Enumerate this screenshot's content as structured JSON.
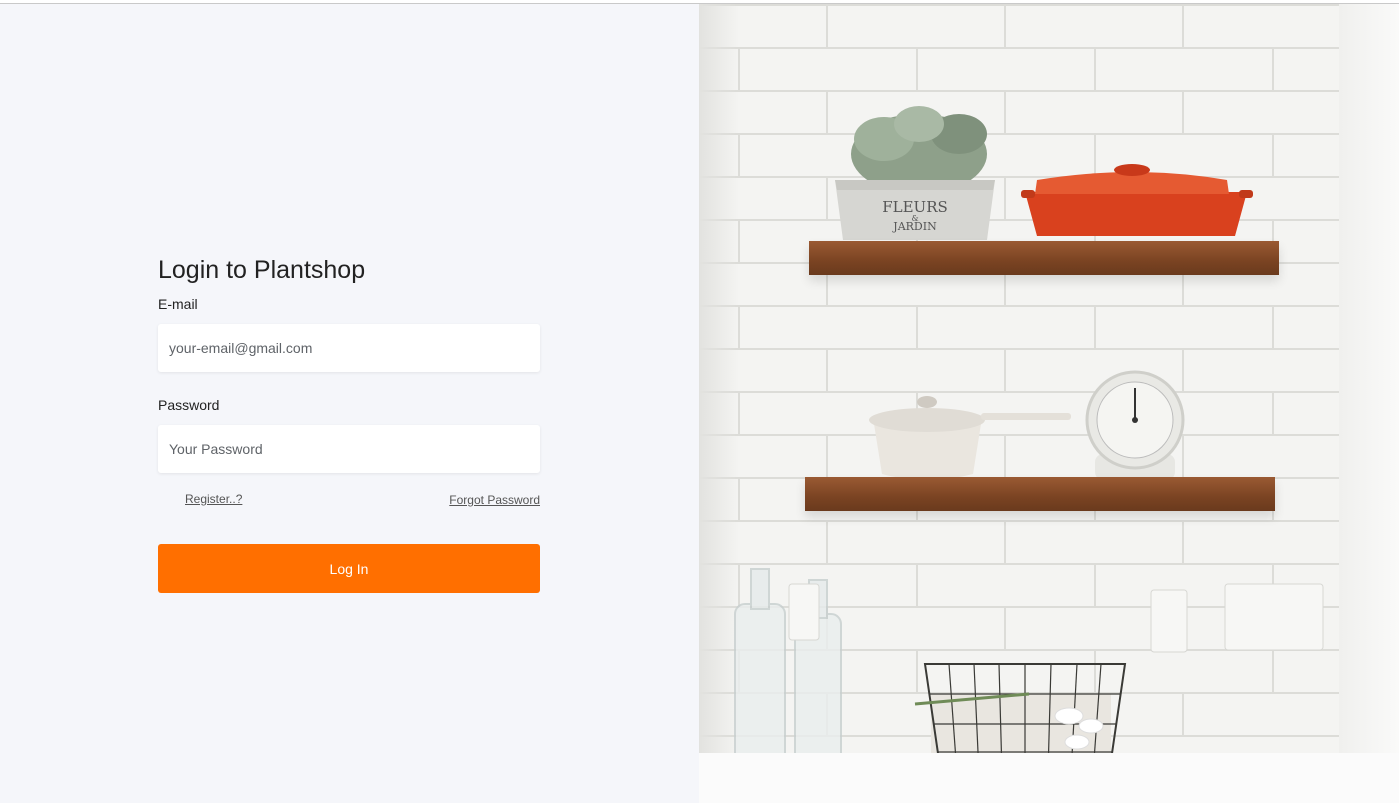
{
  "login": {
    "title": "Login to Plantshop",
    "email_label": "E-mail",
    "email_placeholder": "your-email@gmail.com",
    "password_label": "Password",
    "password_placeholder": "Your Password",
    "register_link": "Register..?",
    "forgot_link": "Forgot Password",
    "login_button": "Log In"
  },
  "photo": {
    "fleurs_text": "FLEURS",
    "amp_text": "&",
    "jardin_text": "JARDIN"
  },
  "colors": {
    "accent": "#ff6f00",
    "left_background": "#f5f6fa"
  }
}
